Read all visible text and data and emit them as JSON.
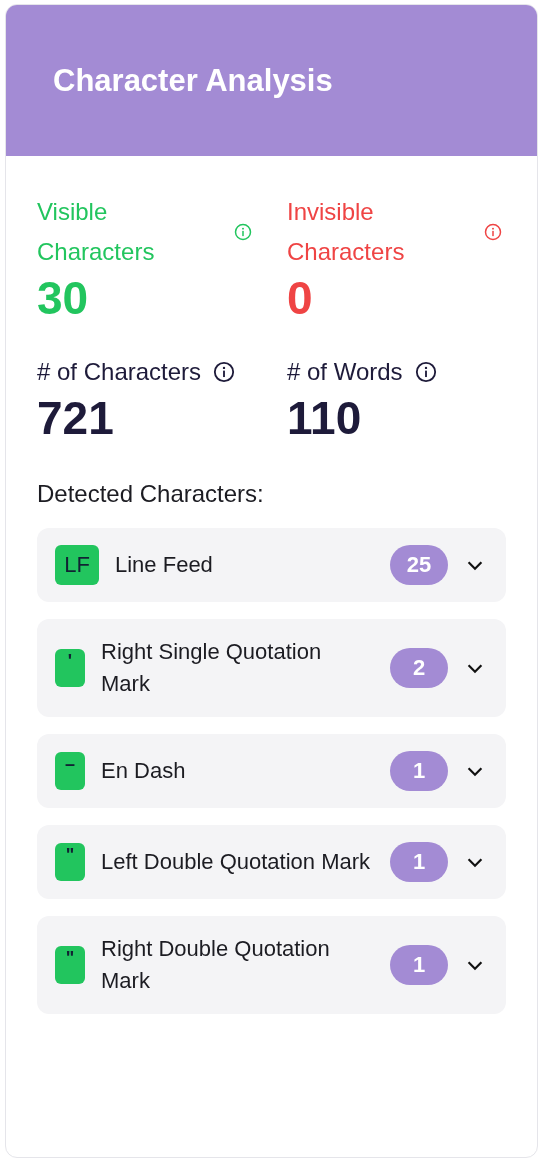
{
  "header": {
    "title": "Character Analysis"
  },
  "stats": [
    {
      "label": "Visible Characters",
      "value": "30",
      "color": "#22c55e"
    },
    {
      "label": "Invisible Characters",
      "value": "0",
      "color": "#ef4444"
    },
    {
      "label": "# of Characters",
      "value": "721",
      "color": "#1e1b3a"
    },
    {
      "label": "# of Words",
      "value": "110",
      "color": "#1e1b3a"
    }
  ],
  "detected": {
    "heading": "Detected Characters:",
    "items": [
      {
        "symbol": "LF",
        "name": "Line Feed",
        "count": "25",
        "expanded": false
      },
      {
        "symbol": "'",
        "name": "Right Single Quotation Mark",
        "count": "2",
        "expanded": false
      },
      {
        "symbol": "–",
        "name": "En Dash",
        "count": "1",
        "expanded": false
      },
      {
        "symbol": "\"",
        "name": "Left Double Quotation Mark",
        "count": "1",
        "expanded": false
      },
      {
        "symbol": "\"",
        "name": "Right Double Quotation Mark",
        "count": "1",
        "expanded": false
      }
    ]
  }
}
